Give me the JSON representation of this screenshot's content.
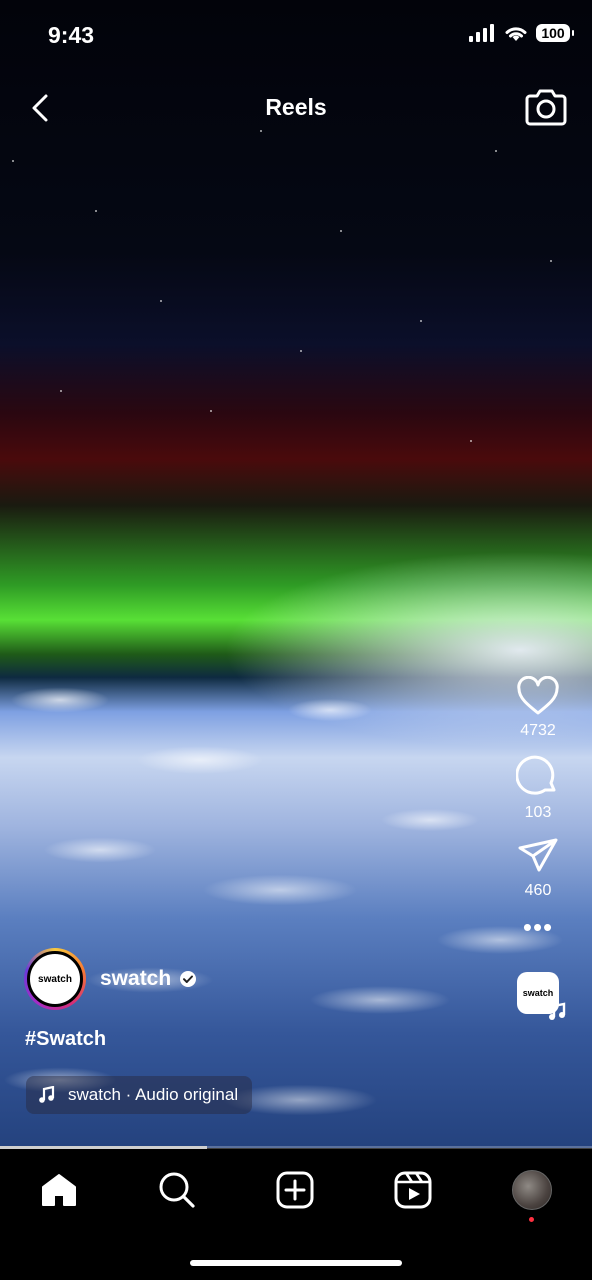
{
  "status_bar": {
    "time": "9:43",
    "battery": "100"
  },
  "header": {
    "title": "Reels"
  },
  "actions": {
    "likes": "4732",
    "comments": "103",
    "shares": "460",
    "more": "•••"
  },
  "reel": {
    "username": "swatch",
    "avatar_text": "swatch",
    "caption": "#Swatch",
    "audio": "swatch · Audio original",
    "audio_thumb_text": "swatch",
    "progress": 0.35
  },
  "icons": [
    "back-icon",
    "camera-icon",
    "heart-icon",
    "comment-icon",
    "share-icon",
    "more-icon",
    "music-note-icon",
    "verified-icon",
    "home-icon",
    "search-icon",
    "create-icon",
    "reels-icon"
  ]
}
